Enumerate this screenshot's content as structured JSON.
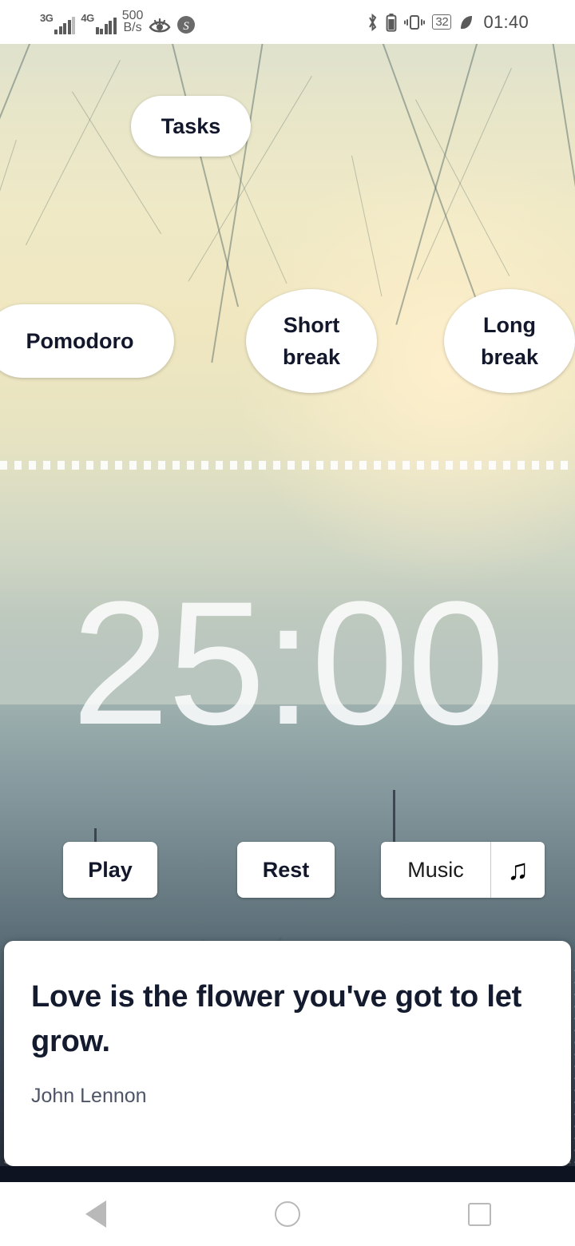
{
  "status_bar": {
    "network_1": "3G",
    "network_2": "4G",
    "data_rate_value": "500",
    "data_rate_unit": "B/s",
    "eye_icon": "eye-icon",
    "s_icon": "s-circle-icon",
    "bluetooth_icon": "bluetooth-icon",
    "battery_icon": "battery-icon",
    "vibrate_icon": "vibrate-icon",
    "battery_percent": "32",
    "eco_icon": "leaf-icon",
    "time": "01:40"
  },
  "app": {
    "tasks_label": "Tasks",
    "modes": [
      {
        "label": "Pomodoro",
        "name": "pomodoro"
      },
      {
        "label": "Short\nbreak",
        "name": "short-break"
      },
      {
        "label": "Long\nbreak",
        "name": "long-break"
      }
    ],
    "mode_pomodoro": "Pomodoro",
    "mode_short_line1": "Short",
    "mode_short_line2": "break",
    "mode_long_line1": "Long",
    "mode_long_line2": "break",
    "timer": "25:00",
    "controls": {
      "play_label": "Play",
      "rest_label": "Rest",
      "music_label": "Music",
      "music_icon": "♫"
    },
    "quote": {
      "text": "Love is the flower you've got to let grow.",
      "author": "John Lennon"
    }
  },
  "nav_bar": {
    "back": "back-button",
    "home": "home-button",
    "recents": "recents-button"
  },
  "colors": {
    "card_bg": "#ffffff",
    "quote_text": "#141b2e",
    "quote_author": "#4e5566",
    "timer_text": "rgba(255,255,255,0.84)",
    "status_icon": "#5a5a5a",
    "nav_icon": "#b9b9b9"
  }
}
